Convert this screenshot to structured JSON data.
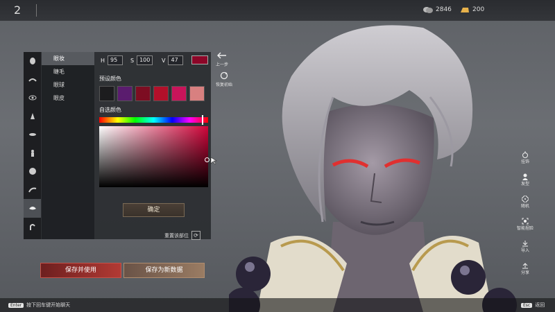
{
  "topbar": {
    "number": "2",
    "currency1": "2846",
    "currency2": "200"
  },
  "categories": [
    "face-icon",
    "brow-icon",
    "eye-icon",
    "nose-icon",
    "mouth-icon",
    "body-icon",
    "head-icon",
    "eyebrow-icon",
    "makeup-icon",
    "ear-icon"
  ],
  "subtabs": [
    "眼妆",
    "睫毛",
    "眼球",
    "眼皮"
  ],
  "hsv": {
    "h_label": "H",
    "h": "95",
    "s_label": "S",
    "s": "100",
    "v_label": "V",
    "v": "47"
  },
  "colors": {
    "current": "#8c0628",
    "presets": [
      "#1c1c1e",
      "#5a1c6e",
      "#7d0d22",
      "#b2102a",
      "#c8145a",
      "#d88080"
    ]
  },
  "labels": {
    "preset": "预设颜色",
    "custom": "自选颜色",
    "confirm": "确定",
    "reset_part": "重置该部位"
  },
  "side_actions": {
    "undo": "上一步",
    "restore": "恢复初始"
  },
  "buttons": {
    "save_use": "保存并使用",
    "save_new": "保存为新数据"
  },
  "right_menu": [
    "挂饰",
    "发型",
    "随机",
    "智能捏脸",
    "导入",
    "分享"
  ],
  "bottom": {
    "enter_key": "Enter",
    "enter_hint": "按下回车键开始聊天",
    "esc_key": "Esc",
    "esc_hint": "返回"
  }
}
